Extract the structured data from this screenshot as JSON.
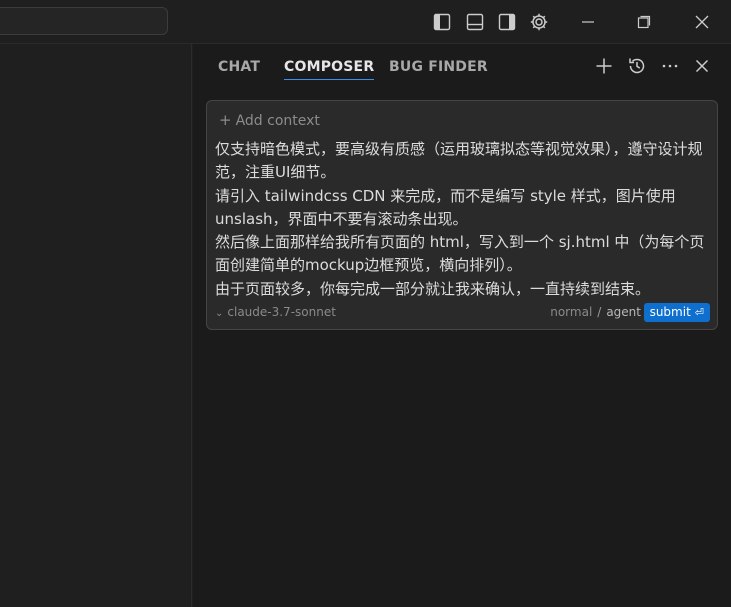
{
  "titlebar": {
    "icons": [
      "toggle-primary-sidebar-icon",
      "toggle-panel-icon",
      "toggle-secondary-sidebar-icon",
      "settings-gear-icon",
      "minimize-icon",
      "maximize-icon",
      "close-window-icon"
    ]
  },
  "panel": {
    "tabs": [
      {
        "label": "CHAT",
        "active": false
      },
      {
        "label": "COMPOSER",
        "active": true
      },
      {
        "label": "BUG FINDER",
        "active": false
      }
    ],
    "actions": [
      "new-icon",
      "history-icon",
      "more-icon",
      "close-icon"
    ]
  },
  "composer": {
    "add_context_label": "Add context",
    "prompt_text": "仅支持暗色模式，要高级有质感（运用玻璃拟态等视觉效果），遵守设计规范，注重UI细节。\n请引入 tailwindcss CDN 来完成，而不是编写 style 样式，图片使用 unslash，界面中不要有滚动条出现。\n然后像上面那样给我所有页面的 html，写入到一个 sj.html 中（为每个页面创建简单的mockup边框预览，横向排列）。\n由于页面较多，你每完成一部分就让我来确认，一直持续到结束。",
    "model": "claude-3.7-sonnet",
    "mode_normal": "normal",
    "mode_separator": "/",
    "mode_agent": "agent",
    "submit_label": "submit",
    "submit_key_glyph": "⏎"
  },
  "colors": {
    "accent": "#3b8eea",
    "submit_bg": "#0e6fcf",
    "background": "#1f1f1f"
  }
}
